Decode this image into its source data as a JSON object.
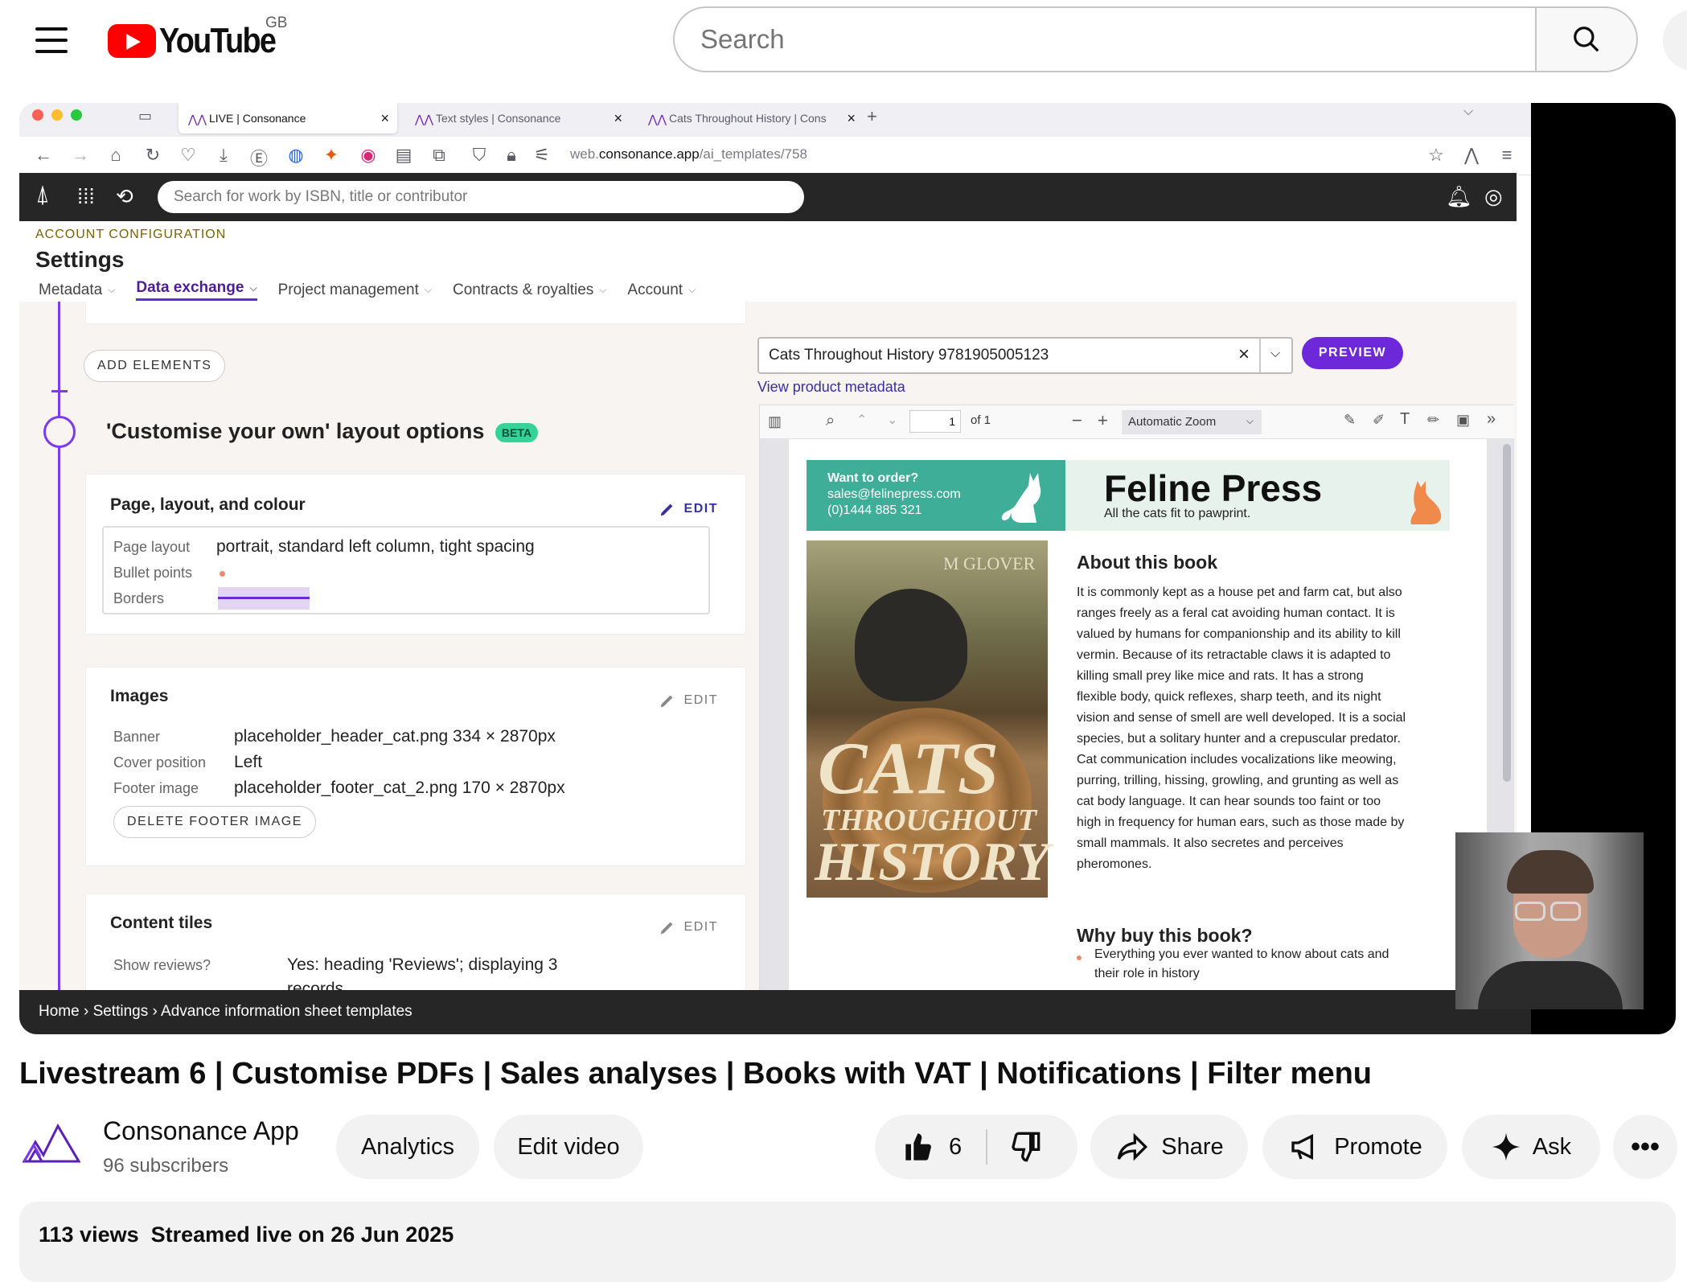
{
  "youtube": {
    "logo_text": "YouTube",
    "region": "GB",
    "search_placeholder": "Search"
  },
  "browser": {
    "tabs": [
      {
        "label": "LIVE | Consonance"
      },
      {
        "label": "Text styles | Consonance"
      },
      {
        "label": "Cats Throughout History | Cons"
      }
    ],
    "url_prefix": "web.",
    "url_domain": "consonance.app",
    "url_path": "/ai_templates/758"
  },
  "app": {
    "search_placeholder": "Search for work by ISBN, title or contributor",
    "section_eyebrow": "ACCOUNT CONFIGURATION",
    "page_title": "Settings",
    "nav": [
      {
        "label": "Metadata"
      },
      {
        "label": "Data exchange"
      },
      {
        "label": "Project management"
      },
      {
        "label": "Contracts & royalties"
      },
      {
        "label": "Account"
      }
    ],
    "add_elements_label": "ADD ELEMENTS",
    "layout_heading": "'Customise your own' layout options",
    "beta_label": "BETA",
    "edit_label": "EDIT",
    "card_page": {
      "title": "Page, layout, and colour",
      "rows": [
        {
          "label": "Page layout",
          "value": "portrait, standard left column, tight spacing"
        },
        {
          "label": "Bullet points",
          "value": ""
        },
        {
          "label": "Borders",
          "value": ""
        }
      ]
    },
    "card_images": {
      "title": "Images",
      "rows": [
        {
          "label": "Banner",
          "value": "placeholder_header_cat.png 334 × 2870px"
        },
        {
          "label": "Cover position",
          "value": "Left"
        },
        {
          "label": "Footer image",
          "value": "placeholder_footer_cat_2.png 170 × 2870px"
        }
      ],
      "delete_label": "DELETE FOOTER IMAGE"
    },
    "card_tiles": {
      "title": "Content tiles",
      "row_label": "Show reviews?",
      "row_value_1": "Yes: heading 'Reviews'; displaying 3",
      "row_value_2": "records"
    },
    "preview": {
      "selected_product": "Cats Throughout History 9781905005123",
      "preview_label": "PREVIEW",
      "metadata_link": "View product metadata",
      "page_number": "1",
      "page_of": "of 1",
      "zoom": "Automatic Zoom"
    },
    "breadcrumb": "Home › Settings › Advance information sheet templates"
  },
  "pdf": {
    "order_title": "Want to order?",
    "order_email": "sales@felinepress.com",
    "order_phone": "(0)1444 885 321",
    "brand_name": "Feline Press",
    "brand_tagline": "All the cats fit to pawprint.",
    "cover_author": "M GLOVER",
    "cover_title_1": "CATS",
    "cover_title_2": "THROUGHOUT",
    "cover_title_3": "HISTORY",
    "about_heading": "About this book",
    "about_lines": [
      "It is commonly kept as a house pet and farm cat, but also",
      "ranges freely as a feral cat avoiding human contact. It is",
      "valued by humans for companionship and its ability to kill",
      "vermin. Because of its retractable claws it is adapted to",
      "killing small prey like mice and rats. It has a strong",
      "flexible body, quick reflexes, sharp teeth, and its night",
      "vision and sense of smell are well developed. It is a social",
      "species, but a solitary hunter and a crepuscular predator.",
      "Cat communication includes vocalizations like meowing,",
      "purring, trilling, hissing, growling, and grunting as well as",
      "cat body language. It can hear sounds too faint or too",
      "high in frequency for human ears, such as those made by",
      "small mammals. It also secretes and perceives",
      "pheromones."
    ],
    "why_heading": "Why buy this book?",
    "why_bullet_1": "Everything you ever wanted to know about cats and",
    "why_bullet_2": "their role in history"
  },
  "video": {
    "title": "Livestream 6 | Customise PDFs | Sales analyses | Books with VAT | Notifications | Filter menu",
    "channel_name": "Consonance App",
    "subscribers": "96 subscribers",
    "analytics_label": "Analytics",
    "edit_video_label": "Edit video",
    "like_count": "6",
    "share_label": "Share",
    "promote_label": "Promote",
    "ask_label": "Ask",
    "views": "113 views",
    "streamed": "Streamed live on 26 Jun 2025"
  },
  "colors": {
    "accent_purple": "#6d28d9",
    "banner_teal": "#3fae98",
    "yt_red": "#ff0000"
  }
}
